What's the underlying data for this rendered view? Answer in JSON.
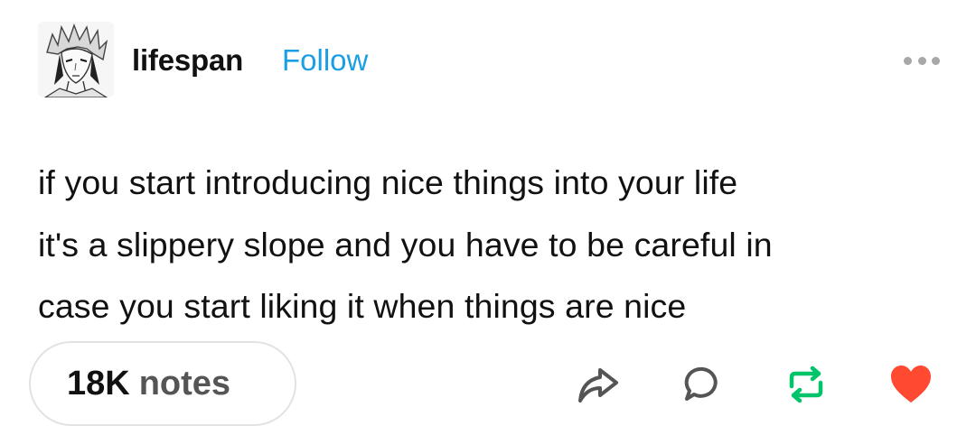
{
  "post": {
    "author": {
      "avatar_icon": "anime-portrait-avatar",
      "username": "lifespan",
      "follow_label": "Follow"
    },
    "more_icon": "ellipsis-icon",
    "body_lines": [
      "if you start introducing nice things into your life",
      "it's a slippery slope and you have to be careful in",
      "case you start liking it when things are nice"
    ],
    "notes": {
      "count": "18K",
      "label": "notes"
    },
    "actions": [
      {
        "icon": "share-icon",
        "color": "#555555"
      },
      {
        "icon": "reply-icon",
        "color": "#555555"
      },
      {
        "icon": "reblog-icon",
        "color": "#00c46a"
      },
      {
        "icon": "heart-icon",
        "color": "#ff4930"
      }
    ],
    "colors": {
      "follow": "#1a9fe6",
      "reblog_active": "#00c46a",
      "like_active": "#ff4930"
    }
  }
}
